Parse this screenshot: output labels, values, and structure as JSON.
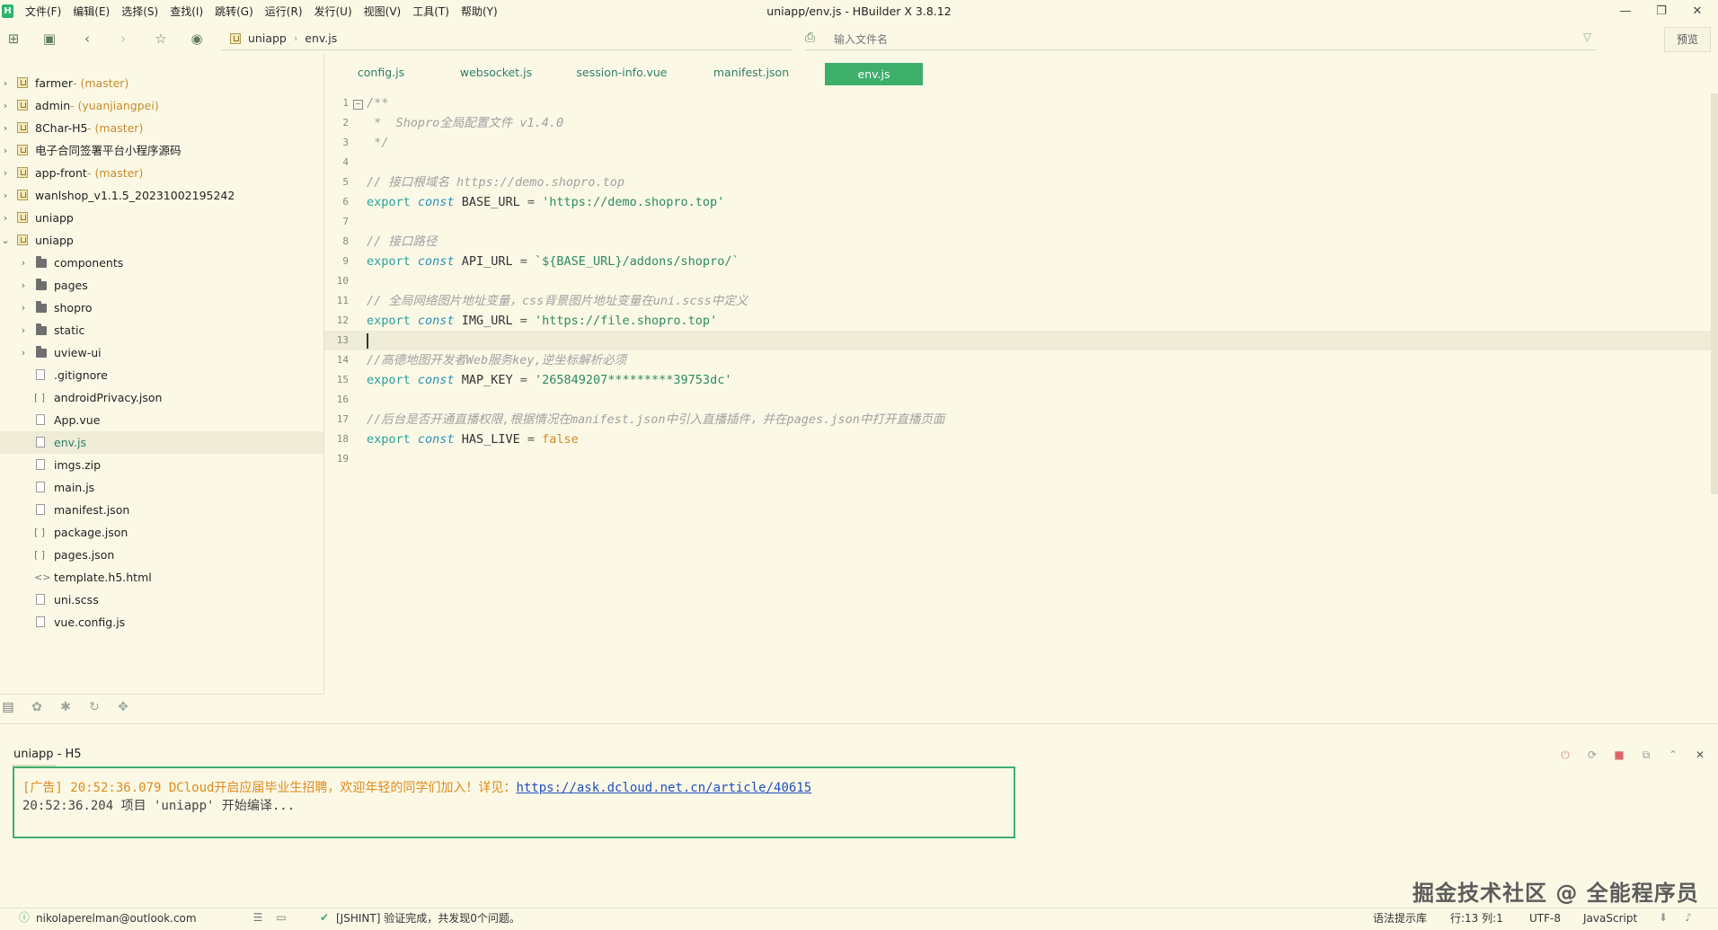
{
  "window": {
    "title": "uniapp/env.js - HBuilder X 3.8.12",
    "logo": "H",
    "controls": [
      "—",
      "❐",
      "✕"
    ]
  },
  "menu": [
    "文件(F)",
    "编辑(E)",
    "选择(S)",
    "查找(I)",
    "跳转(G)",
    "运行(R)",
    "发行(U)",
    "视图(V)",
    "工具(T)",
    "帮助(Y)"
  ],
  "toolbar": {
    "breadcrumb": [
      "uniapp",
      "env.js"
    ],
    "file_search_placeholder": "输入文件名",
    "preview_label": "预览"
  },
  "sidebar": {
    "projects": [
      {
        "name": "farmer",
        "branch": " - (master)"
      },
      {
        "name": "admin",
        "branch": " - (yuanjiangpei)"
      },
      {
        "name": "8Char-H5",
        "branch": " - (master)"
      },
      {
        "name": "电子合同签署平台小程序源码",
        "branch": ""
      },
      {
        "name": "app-front",
        "branch": " - (master)"
      },
      {
        "name": "wanlshop_v1.1.5_20231002195242",
        "branch": ""
      },
      {
        "name": "uniapp",
        "branch": ""
      },
      {
        "name": "uniapp",
        "branch": ""
      }
    ],
    "children": [
      {
        "name": "components",
        "kind": "folder"
      },
      {
        "name": "pages",
        "kind": "folder"
      },
      {
        "name": "shopro",
        "kind": "folder"
      },
      {
        "name": "static",
        "kind": "folder"
      },
      {
        "name": "uview-ui",
        "kind": "folder"
      },
      {
        "name": ".gitignore",
        "kind": "file"
      },
      {
        "name": "androidPrivacy.json",
        "kind": "json"
      },
      {
        "name": "App.vue",
        "kind": "file"
      },
      {
        "name": "env.js",
        "kind": "file"
      },
      {
        "name": "imgs.zip",
        "kind": "file"
      },
      {
        "name": "main.js",
        "kind": "file"
      },
      {
        "name": "manifest.json",
        "kind": "file"
      },
      {
        "name": "package.json",
        "kind": "json"
      },
      {
        "name": "pages.json",
        "kind": "json"
      },
      {
        "name": "template.h5.html",
        "kind": "html"
      },
      {
        "name": "uni.scss",
        "kind": "file"
      },
      {
        "name": "vue.config.js",
        "kind": "file"
      }
    ]
  },
  "tabs": [
    "config.js",
    "websocket.js",
    "session-info.vue",
    "manifest.json",
    "env.js"
  ],
  "editor": {
    "line_numbers": [
      "1",
      "2",
      "3",
      "4",
      "5",
      "6",
      "7",
      "8",
      "9",
      "10",
      "11",
      "12",
      "13",
      "14",
      "15",
      "16",
      "17",
      "18",
      "19"
    ],
    "code": {
      "l1": "/**",
      "l2": " *  Shopro全局配置文件 v1.4.0",
      "l3": " */",
      "l5": "// 接口根域名 https://demo.shopro.top",
      "l6_name": "BASE_URL",
      "l6_value": "'https://demo.shopro.top'",
      "l8": "// 接口路径",
      "l9_name": "API_URL",
      "l9_value": "`${BASE_URL}/addons/shopro/`",
      "l11": "// 全局网络图片地址变量，css背景图片地址变量在uni.scss中定义",
      "l12_name": "IMG_URL",
      "l12_value": "'https://file.shopro.top'",
      "l14": "//高德地图开发者Web服务key,逆坐标解析必须",
      "l15_name": "MAP_KEY",
      "l15_value": "'265849207*********39753dc'",
      "l17": "//后台是否开通直播权限,根据情况在manifest.json中引入直播插件，并在pages.json中打开直播页面",
      "l18_name": "HAS_LIVE",
      "l18_value": "false",
      "kw_export": "export",
      "kw_const": "const",
      "op_eq": " = "
    }
  },
  "console": {
    "title": "uniapp - H5",
    "ad_prefix": "[广告] 20:52:36.079 DCloud开启应届毕业生招聘，欢迎年轻的同学们加入！详见：",
    "ad_link": "https://ask.dcloud.net.cn/article/40615",
    "line2": "20:52:36.204 项目 'uniapp' 开始编译..."
  },
  "watermark": "掘金技术社区 @ 全能程序员",
  "statusbar": {
    "account": "nikolaperelman@outlook.com",
    "lint": "[JSHINT] 验证完成，共发现0个问题。",
    "hint": "语法提示库",
    "position": "行:13  列:1",
    "encoding": "UTF-8",
    "language": "JavaScript"
  },
  "colors": {
    "background": "#fbf9e6",
    "accent": "#3eae6b",
    "comment": "#a0a0a0",
    "string": "#2e8a5e"
  }
}
